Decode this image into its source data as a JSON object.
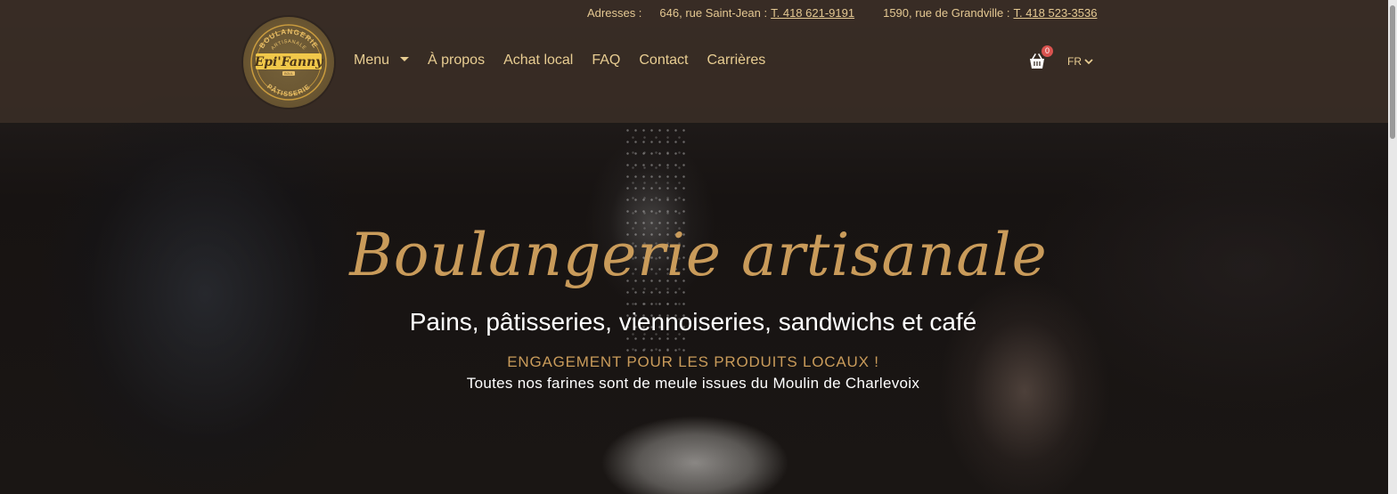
{
  "topbar": {
    "label": "Adresses :",
    "address1": "646, rue Saint-Jean :",
    "phone1": "T. 418 621-9191",
    "address2": "1590, rue de Grandville :",
    "phone2": "T. 418 523-3536"
  },
  "logo": {
    "top_text": "BOULANGERIE",
    "mid_text": "ARTISANALE",
    "brand": "Epi'Fanny",
    "small": "BOUL",
    "bottom_text": "PÂTISSERIE"
  },
  "nav": {
    "items": [
      {
        "label": "Menu",
        "has_dropdown": true
      },
      {
        "label": "À propos"
      },
      {
        "label": "Achat local"
      },
      {
        "label": "FAQ"
      },
      {
        "label": "Contact"
      },
      {
        "label": "Carrières"
      }
    ]
  },
  "cart": {
    "count": "0",
    "icon": "basket-icon"
  },
  "lang": {
    "current": "FR",
    "icon": "chevron-down-icon"
  },
  "hero": {
    "title": "Boulangerie artisanale",
    "subtitle": "Pains, pâtisseries, viennoiseries, sandwichs et café",
    "engagement": "ENGAGEMENT POUR LES PRODUITS LOCAUX !",
    "flour_note": "Toutes nos farines sont de meule issues du Moulin de Charlevoix"
  },
  "colors": {
    "gold": "#c99b5a",
    "nav_text": "#e8cd92",
    "header_bg": "#3a2e26",
    "badge": "#d9534f"
  }
}
